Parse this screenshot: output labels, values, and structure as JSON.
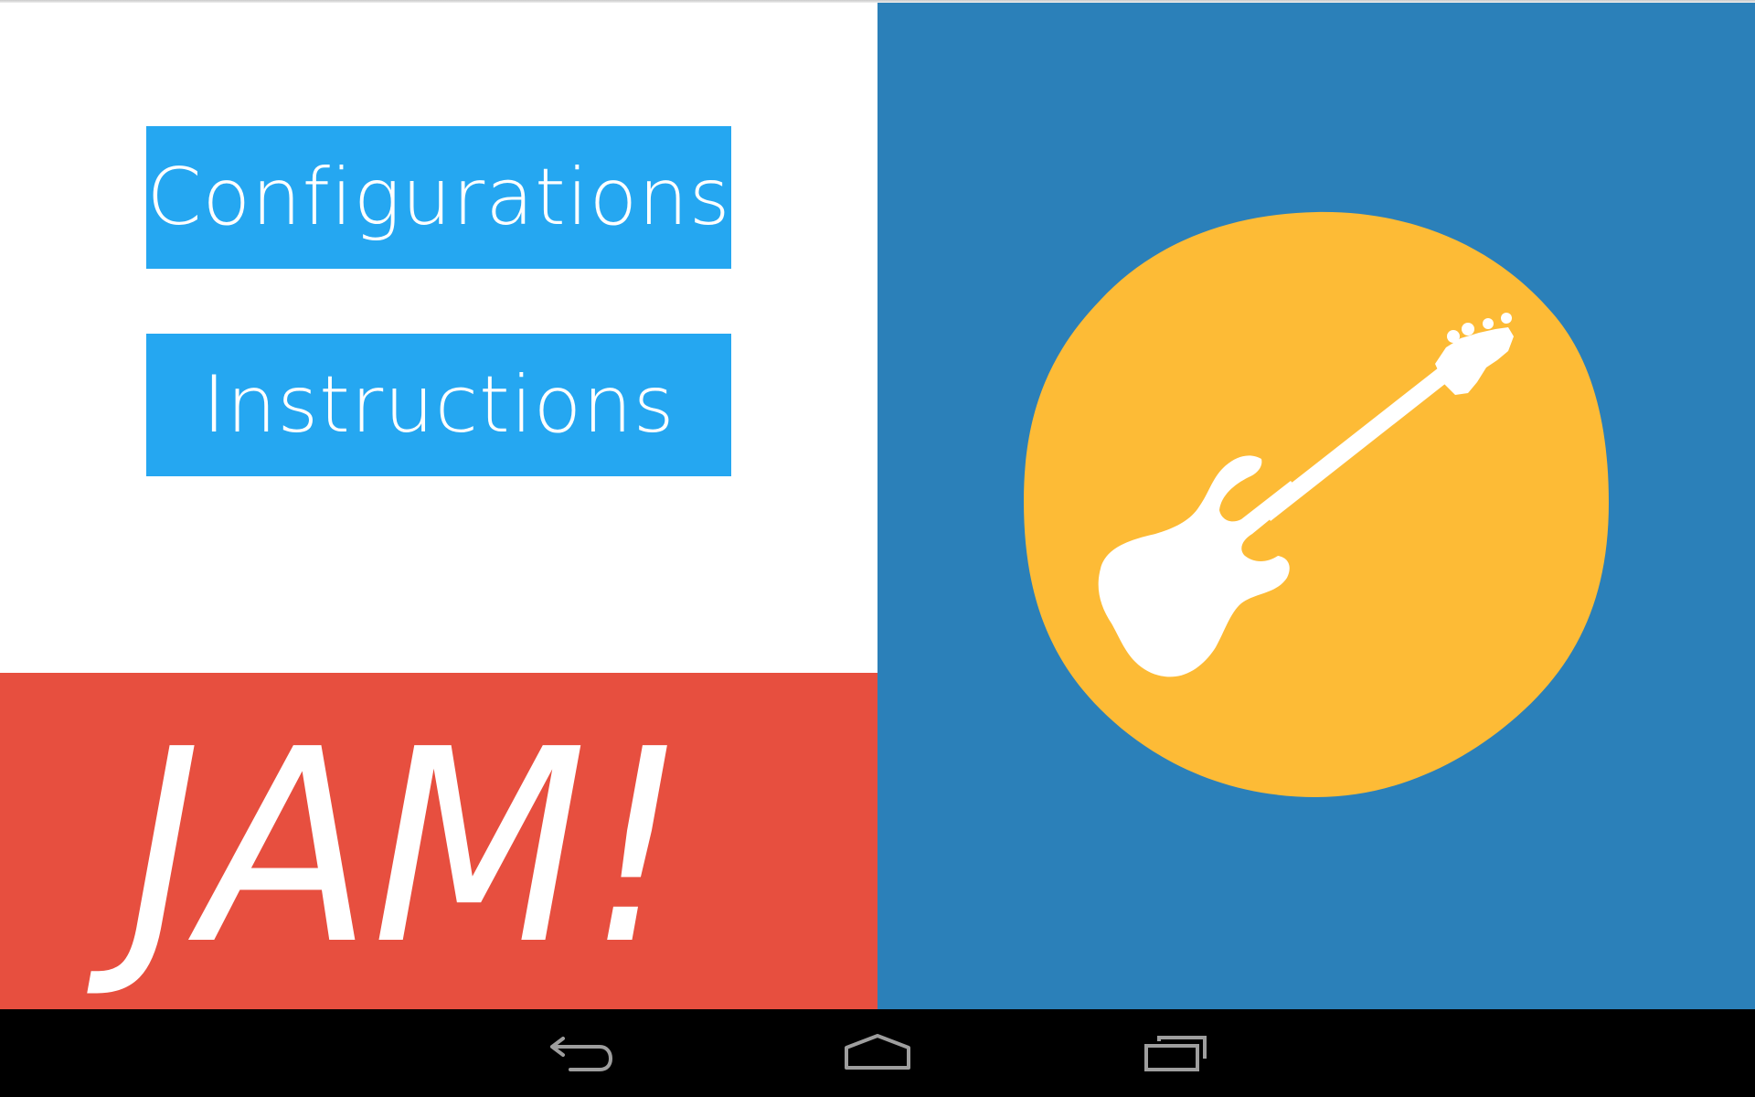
{
  "colors": {
    "background": "#ffffff",
    "button_blue": "#25a7f1",
    "jam_red": "#e74f3f",
    "panel_blue": "#2b80b9",
    "badge_yellow": "#fdbb36",
    "guitar_white": "#ffffff",
    "nav_bar": "#000000",
    "nav_icon": "#9e9e9e"
  },
  "menu": {
    "configurations_label": "Configurations",
    "instructions_label": "Instructions"
  },
  "jam": {
    "label": "JAM!"
  },
  "illustration": {
    "icon": "bass-guitar-icon"
  },
  "nav_bar": {
    "back_icon": "back-arrow-icon",
    "home_icon": "home-icon",
    "recent_icon": "recent-apps-icon"
  }
}
